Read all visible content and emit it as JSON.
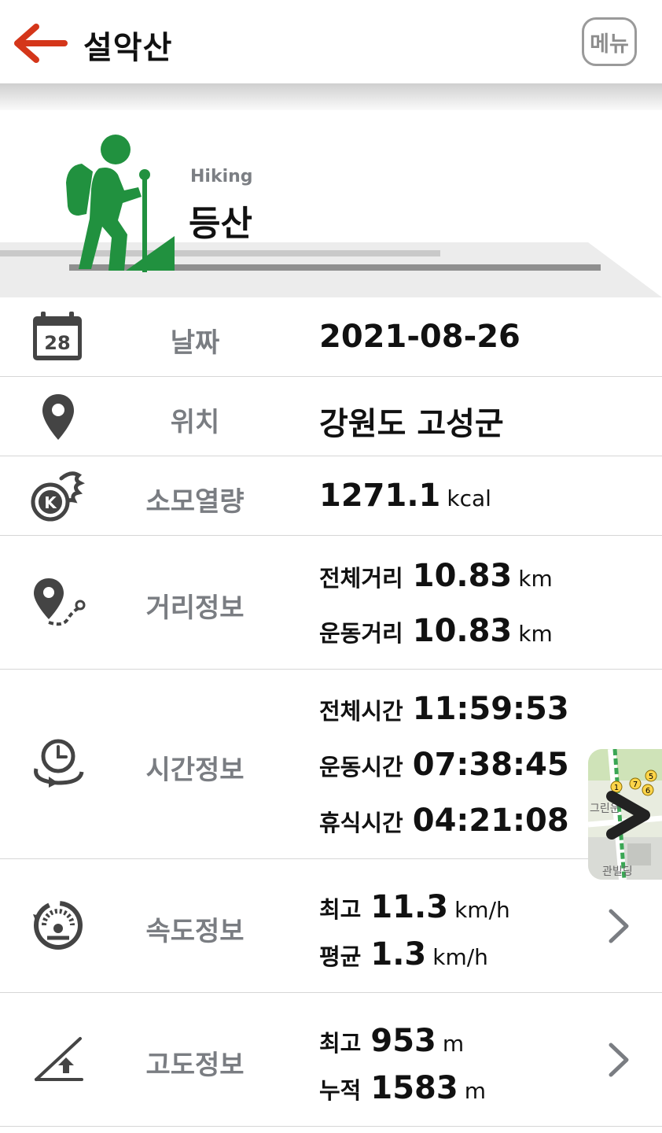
{
  "header": {
    "title": "설악산",
    "menu_label": "메뉴",
    "accent_color": "#d4361a"
  },
  "activity": {
    "subtitle": "Hiking",
    "name": "등산",
    "icon": "hiker-icon",
    "icon_color": "#21913f"
  },
  "rows": {
    "date": {
      "icon": "calendar-icon",
      "icon_day": "28",
      "label": "날짜",
      "value": "2021-08-26"
    },
    "location": {
      "icon": "location-pin-icon",
      "label": "위치",
      "value": "강원도 고성군"
    },
    "calories": {
      "icon": "calorie-flame-icon",
      "icon_letter": "K",
      "label": "소모열량",
      "value": "1271.1",
      "unit": "kcal"
    },
    "distance": {
      "icon": "route-pin-icon",
      "label": "거리정보",
      "items": [
        {
          "label": "전체거리",
          "value": "10.83",
          "unit": "km"
        },
        {
          "label": "운동거리",
          "value": "10.83",
          "unit": "km"
        }
      ]
    },
    "time": {
      "icon": "clock-icon",
      "label": "시간정보",
      "items": [
        {
          "label": "전체시간",
          "value": "11:59:53"
        },
        {
          "label": "운동시간",
          "value": "07:38:45"
        },
        {
          "label": "휴식시간",
          "value": "04:21:08"
        }
      ]
    },
    "speed": {
      "icon": "speedometer-icon",
      "label": "속도정보",
      "items": [
        {
          "label": "최고",
          "value": "11.3",
          "unit": "km/h"
        },
        {
          "label": "평균",
          "value": "1.3",
          "unit": "km/h"
        }
      ]
    },
    "altitude": {
      "icon": "altitude-icon",
      "label": "고도정보",
      "items": [
        {
          "label": "최고",
          "value": "953",
          "unit": "m"
        },
        {
          "label": "누적",
          "value": "1583",
          "unit": "m"
        }
      ]
    }
  },
  "map_thumbnail": {
    "icon": "map-thumbnail-icon",
    "markers": [
      "1",
      "7",
      "6",
      "5"
    ],
    "text_top": "그린운",
    "text_bottom": "관빌딩"
  }
}
